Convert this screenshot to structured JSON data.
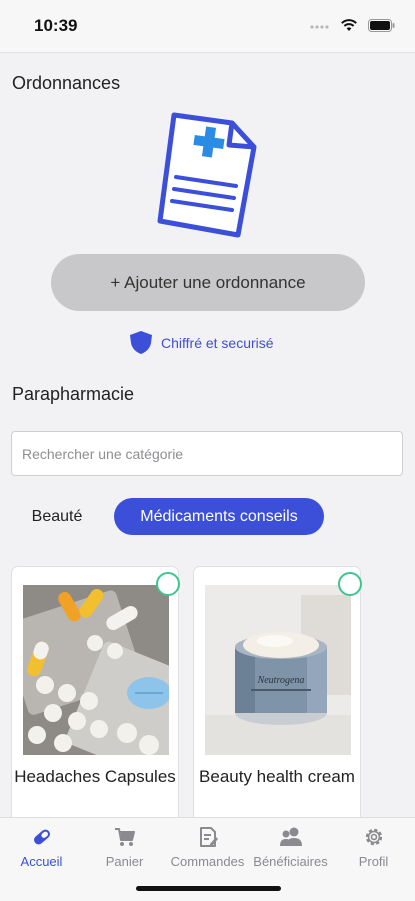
{
  "status_bar": {
    "time": "10:39"
  },
  "prescriptions": {
    "title": "Ordonnances",
    "add_button_label": "+ Ajouter une ordonnance",
    "secure_label": "Chiffré et securisé"
  },
  "parapharmacy": {
    "title": "Parapharmacie",
    "search_placeholder": "Rechercher une catégorie",
    "categories": [
      {
        "label": "Beauté",
        "selected": false
      },
      {
        "label": "Médicaments conseils",
        "selected": true
      }
    ],
    "products": [
      {
        "title": "Headaches Capsules"
      },
      {
        "title": "Beauty health cream"
      }
    ]
  },
  "tab_bar": {
    "items": [
      {
        "label": "Accueil",
        "icon": "pill-icon",
        "active": true
      },
      {
        "label": "Panier",
        "icon": "cart-icon",
        "active": false
      },
      {
        "label": "Commandes",
        "icon": "orders-icon",
        "active": false
      },
      {
        "label": "Bénéficiaires",
        "icon": "people-icon",
        "active": false
      },
      {
        "label": "Profil",
        "icon": "gear-icon",
        "active": false
      }
    ]
  },
  "colors": {
    "accent": "#3b4fd8",
    "selection_ring": "#3fc48f",
    "button_gray": "#c8c8ca"
  }
}
